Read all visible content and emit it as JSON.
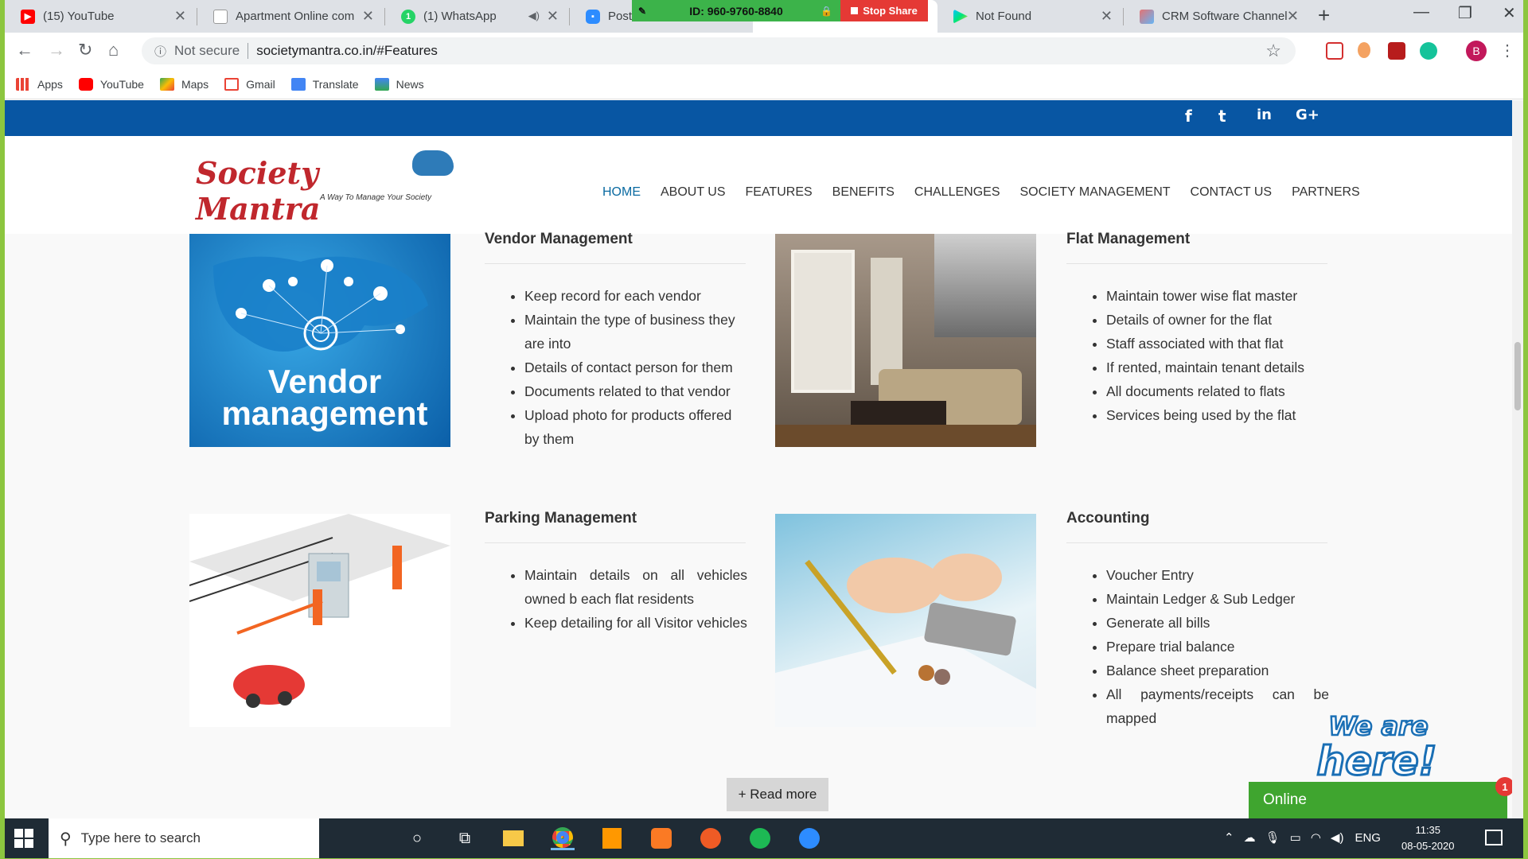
{
  "browser": {
    "tabs": [
      {
        "title": "(15) YouTube",
        "icon": "youtube-icon"
      },
      {
        "title": "Apartment Online com",
        "icon": "document-icon"
      },
      {
        "title": "(1) WhatsApp",
        "icon": "whatsapp-icon"
      },
      {
        "title": "Post A",
        "icon": "zoom-icon"
      },
      {
        "title": "Not Found",
        "icon": "play-store-icon"
      },
      {
        "title": "CRM Software Channel",
        "icon": "crm-icon"
      }
    ],
    "share_id": "ID: 960-9760-8840",
    "stop_share": "Stop Share",
    "security": "Not secure",
    "url": "societymantra.co.in/#Features",
    "profile_initial": "B",
    "bookmarks": [
      {
        "label": "Apps",
        "icon": "apps-grid-icon"
      },
      {
        "label": "YouTube",
        "icon": "youtube-icon"
      },
      {
        "label": "Maps",
        "icon": "maps-icon"
      },
      {
        "label": "Gmail",
        "icon": "gmail-icon"
      },
      {
        "label": "Translate",
        "icon": "translate-icon"
      },
      {
        "label": "News",
        "icon": "news-icon"
      }
    ]
  },
  "site": {
    "logo_text": "Society Mantra",
    "logo_tagline": "A Way To Manage Your Society",
    "social": [
      "f",
      "t",
      "in",
      "G+"
    ],
    "nav": [
      "HOME",
      "ABOUT US",
      "FEATURES",
      "BENEFITS",
      "CHALLENGES",
      "SOCIETY MANAGEMENT",
      "CONTACT US",
      "PARTNERS"
    ],
    "features": [
      {
        "title": "Vendor Management",
        "image_text": [
          "Vendor",
          "management"
        ],
        "items": [
          "Keep record for each vendor",
          "Maintain the type of business they are into",
          "Details of contact person for them",
          "Documents related to that vendor",
          "Upload photo for products offered by them"
        ]
      },
      {
        "title": "Flat Management",
        "items": [
          "Maintain tower wise flat master",
          "Details of owner for the flat",
          "Staff associated with that flat",
          "If rented, maintain tenant details",
          "All documents related to flats",
          "Services being used by the flat"
        ]
      },
      {
        "title": "Parking Management",
        "items": [
          "Maintain details on all vehicles owned b each flat residents",
          "Keep detailing for all Visitor vehicles"
        ]
      },
      {
        "title": "Accounting",
        "items": [
          "Voucher Entry",
          "Maintain Ledger & Sub Ledger",
          "Generate all bills",
          "Prepare trial balance",
          "Balance sheet preparation",
          "All payments/receipts can be mapped"
        ]
      }
    ],
    "read_more": "+ Read more",
    "chat": {
      "we_are": "We are",
      "here": "here!",
      "status": "Online",
      "unread": "1"
    }
  },
  "taskbar": {
    "search_placeholder": "Type here to search",
    "language": "ENG",
    "time": "11:35",
    "date": "08-05-2020"
  }
}
